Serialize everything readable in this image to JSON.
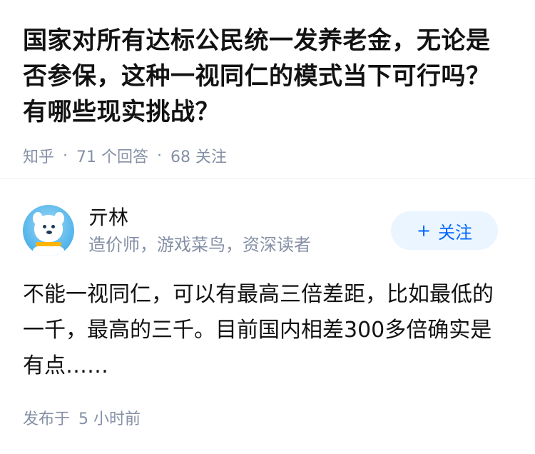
{
  "question": {
    "title": "国家对所有达标公民统一发养老金，无论是否参保，这种一视同仁的模式当下可行吗？有哪些现实挑战？",
    "source": "知乎",
    "separator": "·",
    "answer_count": "71 个回答",
    "follower_count": "68 关注"
  },
  "answer": {
    "author": {
      "name": "亓林",
      "bio": "造价师，游戏菜鸟，资深读者",
      "avatar_icon": "polar-bear-avatar"
    },
    "follow_button": {
      "icon": "+",
      "label": "关注"
    },
    "excerpt": "不能一视同仁，可以有最高三倍差距，比如最低的一千，最高的三千。目前国内相差300多倍确实是有点……",
    "published_prefix": "发布于",
    "published_time": "5 小时前"
  },
  "colors": {
    "primary": "#0066ff",
    "button_bg": "#ebf5ff",
    "meta_text": "#8590a6",
    "title_text": "#121212"
  }
}
